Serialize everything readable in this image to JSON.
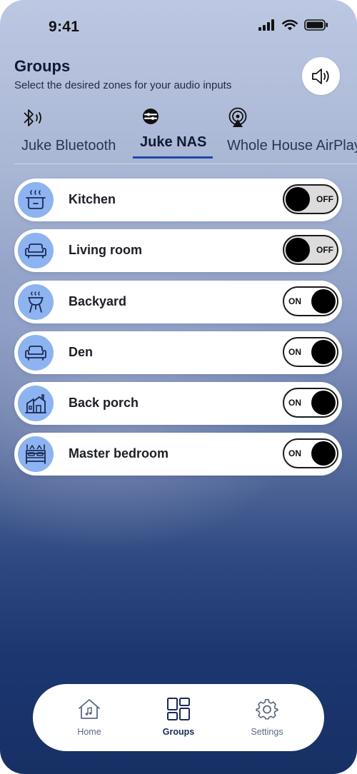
{
  "status_bar": {
    "time": "9:41",
    "icons": [
      "cellular-signal-icon",
      "wifi-icon",
      "battery-icon"
    ]
  },
  "header": {
    "title": "Groups",
    "subtitle": "Select the desired zones for your audio inputs",
    "volume_icon": "speaker-volume-icon"
  },
  "tabs": [
    {
      "label": "Juke Bluetooth",
      "icon": "bluetooth-audio-icon",
      "active": false
    },
    {
      "label": "Juke NAS",
      "icon": "nas-storage-icon",
      "active": true
    },
    {
      "label": "Whole House AirPlay",
      "icon": "airplay-icon",
      "active": false
    }
  ],
  "zones": [
    {
      "name": "Kitchen",
      "icon": "cooking-pot-icon",
      "state": "OFF"
    },
    {
      "name": "Living room",
      "icon": "sofa-icon",
      "state": "OFF"
    },
    {
      "name": "Backyard",
      "icon": "grill-icon",
      "state": "ON"
    },
    {
      "name": "Den",
      "icon": "sofa-icon",
      "state": "ON"
    },
    {
      "name": "Back porch",
      "icon": "house-porch-icon",
      "state": "ON"
    },
    {
      "name": "Master bedroom",
      "icon": "bed-icon",
      "state": "ON"
    }
  ],
  "bottom_nav": [
    {
      "label": "Home",
      "icon": "home-icon",
      "active": false
    },
    {
      "label": "Groups",
      "icon": "groups-grid-icon",
      "active": true
    },
    {
      "label": "Settings",
      "icon": "gear-icon",
      "active": false
    }
  ],
  "colors": {
    "accent": "#1b49a8",
    "zone_icon_bg": "#8db3f0",
    "toggle_off_bg": "#dcdcdc",
    "toggle_knob": "#000000"
  }
}
